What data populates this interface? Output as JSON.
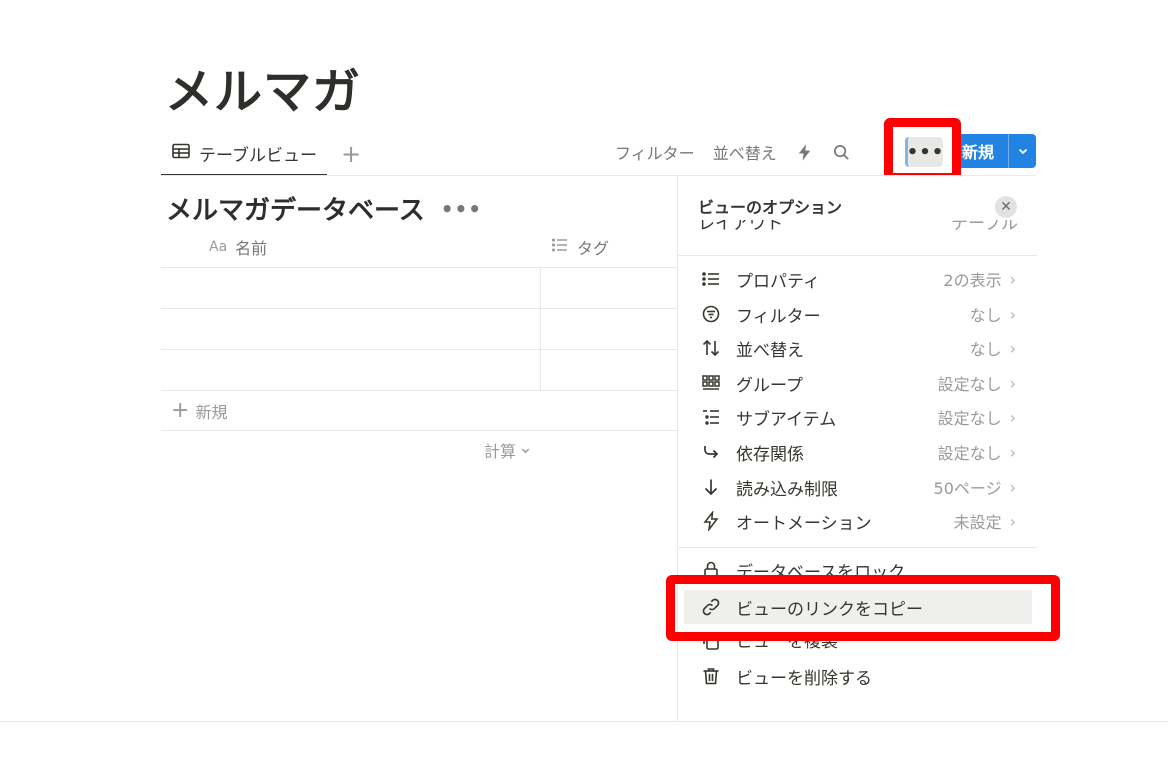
{
  "page": {
    "title": "メルマガ"
  },
  "tabs": [
    {
      "label": "テーブルビュー"
    }
  ],
  "tab_add": "+",
  "toolbar": {
    "filter_label": "フィルター",
    "sort_label": "並べ替え",
    "more_label": "•••",
    "new_label": "新規"
  },
  "database": {
    "title": "メルマガデータベース",
    "more": "•••",
    "columns": {
      "name_prefix": "Aa",
      "name": "名前",
      "tag": "タグ"
    },
    "add_row_label": "新規",
    "calc_label": "計算"
  },
  "panel": {
    "title": "ビューのオプション",
    "clipped": {
      "label": "レイアウト",
      "value": "テーブル"
    },
    "options": [
      {
        "icon": "list-icon",
        "label": "プロパティ",
        "value": "2の表示"
      },
      {
        "icon": "filter-icon",
        "label": "フィルター",
        "value": "なし"
      },
      {
        "icon": "sort-icon",
        "label": "並べ替え",
        "value": "なし"
      },
      {
        "icon": "group-icon",
        "label": "グループ",
        "value": "設定なし"
      },
      {
        "icon": "sub-items-icon",
        "label": "サブアイテム",
        "value": "設定なし"
      },
      {
        "icon": "dependency-icon",
        "label": "依存関係",
        "value": "設定なし"
      },
      {
        "icon": "arrow-down-icon",
        "label": "読み込み制限",
        "value": "50ページ"
      },
      {
        "icon": "lightning-icon",
        "label": "オートメーション",
        "value": "未設定"
      }
    ],
    "actions": [
      {
        "icon": "lock-icon",
        "label": "データベースをロック"
      },
      {
        "icon": "link-icon",
        "label": "ビューのリンクをコピー"
      },
      {
        "icon": "duplicate-icon",
        "label": "ビューを複製"
      },
      {
        "icon": "trash-icon",
        "label": "ビューを削除する"
      }
    ]
  },
  "colors": {
    "highlight": "#ff0000",
    "primary": "#2383e2"
  }
}
